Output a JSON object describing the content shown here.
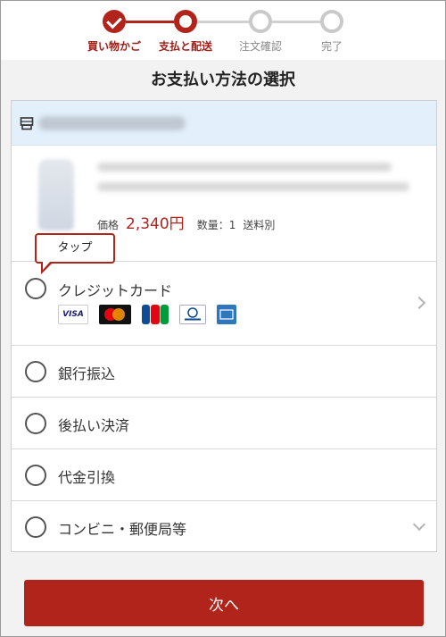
{
  "stepper": {
    "steps": [
      {
        "label": "買い物かご",
        "state": "done"
      },
      {
        "label": "支払と配送",
        "state": "current"
      },
      {
        "label": "注文確認",
        "state": "todo"
      },
      {
        "label": "完了",
        "state": "todo"
      }
    ]
  },
  "page": {
    "title": "お支払い方法の選択"
  },
  "cart": {
    "price_label": "価格",
    "price_value": "2,340円",
    "quantity": "数量：1",
    "shipping": "送料別"
  },
  "tooltip": {
    "text": "タップ"
  },
  "payment_options": [
    {
      "label": "クレジットカード",
      "indicator": "chevron-right"
    },
    {
      "label": "銀行振込",
      "indicator": "none"
    },
    {
      "label": "後払い決済",
      "indicator": "none"
    },
    {
      "label": "代金引換",
      "indicator": "none"
    },
    {
      "label": "コンビニ・郵便局等",
      "indicator": "chevron-down"
    }
  ],
  "card_brands": [
    {
      "name": "VISA",
      "icon": "visa-logo"
    },
    {
      "name": "mastercard",
      "icon": "mastercard-logo"
    },
    {
      "name": "JCB",
      "icon": "jcb-logo"
    },
    {
      "name": "Diners Club",
      "icon": "diners-logo"
    },
    {
      "name": "AMEX",
      "icon": "amex-logo"
    }
  ],
  "actions": {
    "next_label": "次へ"
  },
  "colors": {
    "accent": "#b1241b",
    "shop_bar": "#e3f0fb",
    "inactive": "#c9c9c9"
  }
}
